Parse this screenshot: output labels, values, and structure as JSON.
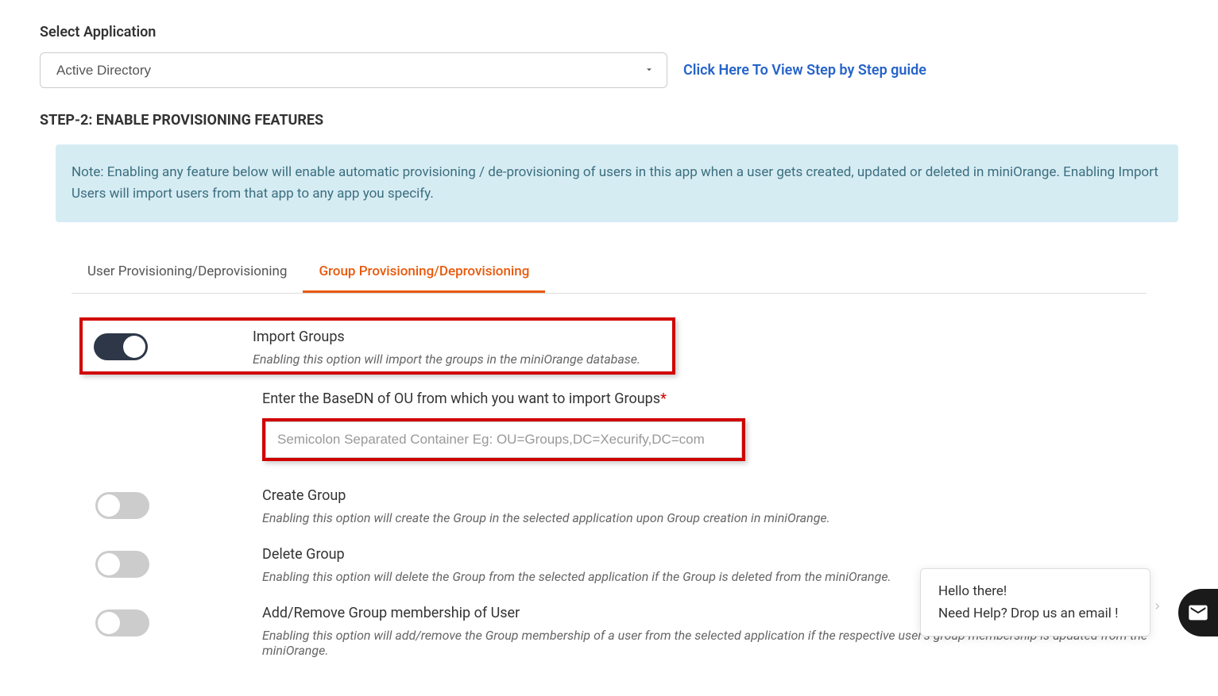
{
  "header": {
    "select_label": "Select Application",
    "selected_app": "Active Directory",
    "guide_link": "Click Here To View Step by Step guide"
  },
  "step": {
    "title": "STEP-2: ENABLE PROVISIONING FEATURES",
    "note": "Note: Enabling any feature below will enable automatic provisioning / de-provisioning of users in this app when a user gets created, updated or deleted in miniOrange. Enabling Import Users will import users from that app to any app you specify."
  },
  "tabs": {
    "user": "User Provisioning/Deprovisioning",
    "group": "Group Provisioning/Deprovisioning"
  },
  "features": {
    "import_groups": {
      "title": "Import Groups",
      "desc": "Enabling this option will import the groups in the miniOrange database."
    },
    "basedn": {
      "label": "Enter the BaseDN of OU from which you want to import Groups",
      "placeholder": "Semicolon Separated Container Eg: OU=Groups,DC=Xecurify,DC=com"
    },
    "create_group": {
      "title": "Create Group",
      "desc": "Enabling this option will create the Group in the selected application upon Group creation in miniOrange."
    },
    "delete_group": {
      "title": "Delete Group",
      "desc": "Enabling this option will delete the Group from the selected application if the Group is deleted from the miniOrange."
    },
    "add_remove": {
      "title": "Add/Remove Group membership of User",
      "desc": "Enabling this option will add/remove the Group membership of a user from the selected application if the respective user's group membership is updated from the miniOrange."
    }
  },
  "chat": {
    "line1": "Hello there!",
    "line2": "Need Help? Drop us an email !"
  }
}
